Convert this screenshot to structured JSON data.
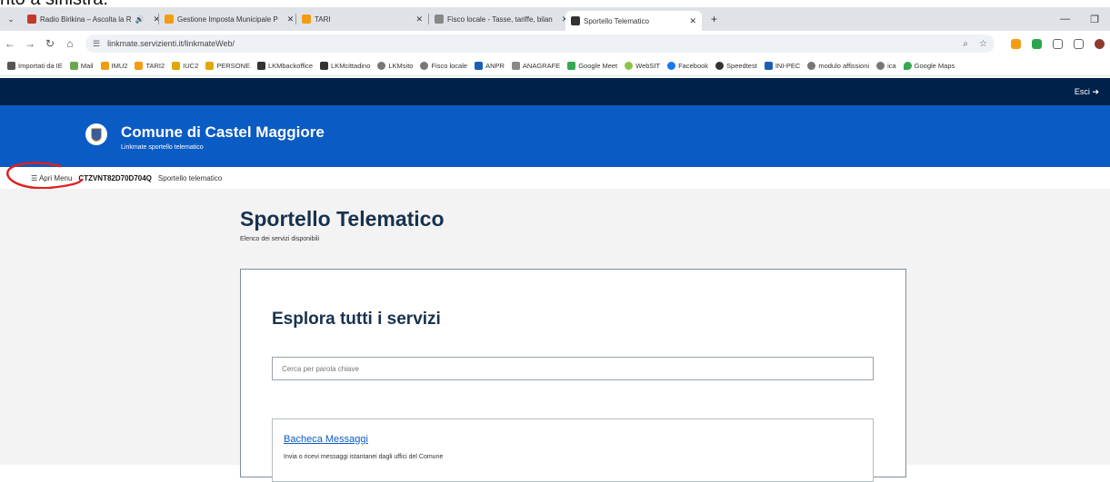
{
  "caption": "nto a sinistra.",
  "browser": {
    "tabs": [
      {
        "label": "Radio Birikina – Ascolta la R",
        "audio": "🔊",
        "active": false
      },
      {
        "label": "Gestione Imposta Municipale P",
        "active": false
      },
      {
        "label": "TARI",
        "active": false
      },
      {
        "label": "Fisco locale - Tasse, tariffe, bilan",
        "active": false
      },
      {
        "label": "Sportello Telematico",
        "active": true
      }
    ],
    "address": "linkmate.servizienti.it/linkmateWeb/",
    "bookmarks": [
      {
        "label": "Importati da IE",
        "color": "#555"
      },
      {
        "label": "Mail",
        "color": "#6aa84f"
      },
      {
        "label": "IMU2",
        "color": "#f39c12"
      },
      {
        "label": "TARI2",
        "color": "#f39c12"
      },
      {
        "label": "IUC2",
        "color": "#e0a800"
      },
      {
        "label": "PERSONE",
        "color": "#e0a800"
      },
      {
        "label": "LKMbackoffice",
        "color": "#333"
      },
      {
        "label": "LKMcittadino",
        "color": "#333"
      },
      {
        "label": "LKMsito",
        "color": "#777"
      },
      {
        "label": "Fisco locale",
        "color": "#777"
      },
      {
        "label": "ANPR",
        "color": "#1a5fb4"
      },
      {
        "label": "ANAGRAFE",
        "color": "#888"
      },
      {
        "label": "Google Meet",
        "color": "#34a853"
      },
      {
        "label": "WebSIT",
        "color": "#8bc34a"
      },
      {
        "label": "Facebook",
        "color": "#1877f2"
      },
      {
        "label": "Speedtest",
        "color": "#333"
      },
      {
        "label": "INI-PEC",
        "color": "#1a5fb4"
      },
      {
        "label": "modulo affissioni",
        "color": "#777"
      },
      {
        "label": "ica",
        "color": "#777"
      },
      {
        "label": "Google Maps",
        "color": "#34a853"
      }
    ]
  },
  "site": {
    "logout_label": "Esci",
    "org_name": "Comune di Castel Maggiore",
    "org_subtitle": "Linkmate sportello telematico",
    "menu_label": "Apri Menu",
    "user_code": "CTZVNT82D70D704Q",
    "breadcrumb": "Sportello telematico",
    "page_title": "Sportello Telematico",
    "page_subtitle": "Elenco dei servizi disponibili",
    "card_title": "Esplora tutti i servizi",
    "search_placeholder": "Cerca per parola chiave",
    "service_title": "Bacheca Messaggi",
    "service_desc": "Invia o ricevi messaggi istantanei dagli uffici del Comune"
  },
  "colors": {
    "topbar": "#00224a",
    "header": "#0a5bc4",
    "annotation": "#e02020"
  }
}
